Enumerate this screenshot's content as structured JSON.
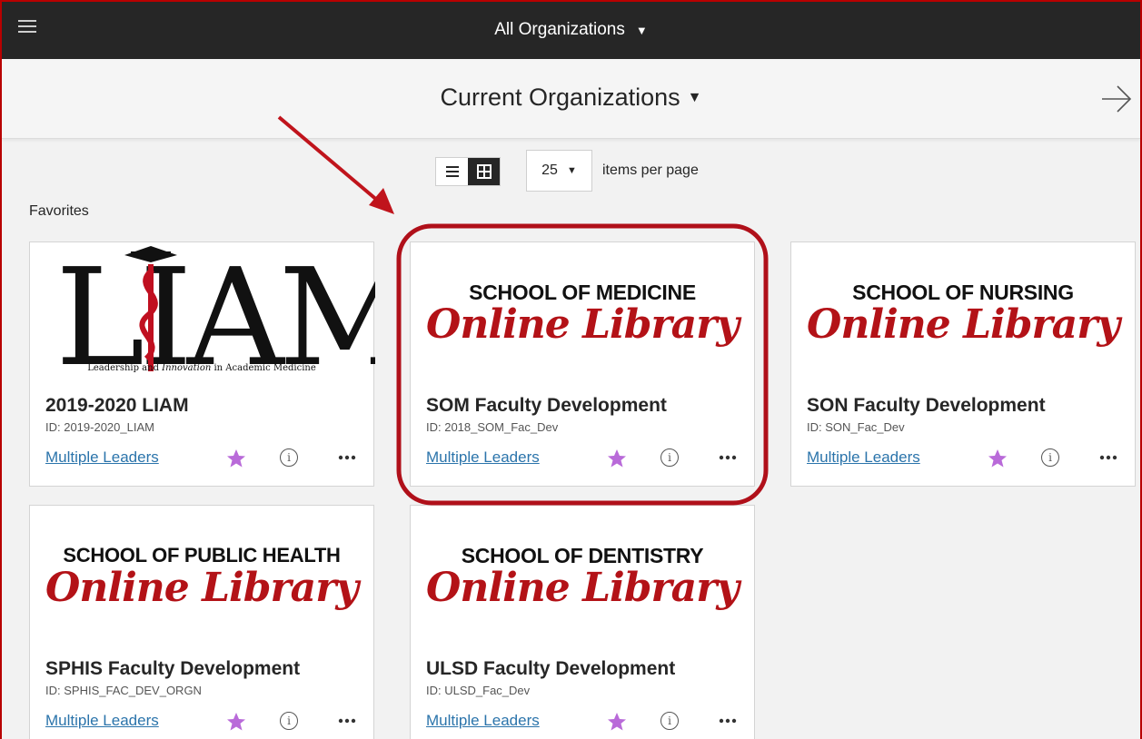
{
  "topbar": {
    "org_selector": "All Organizations"
  },
  "header": {
    "title": "Current Organizations"
  },
  "toolbar": {
    "per_page_value": "25",
    "per_page_label": "items per page"
  },
  "section": {
    "favorites_label": "Favorites"
  },
  "colors": {
    "accent_red": "#b80000",
    "star_purple": "#b96ad9",
    "link_blue": "#2b74ab",
    "logo_red": "#b31217"
  },
  "cards": [
    {
      "title": "2019-2020 LIAM",
      "id": "ID: 2019-2020_LIAM",
      "leaders": "Multiple Leaders",
      "logo": {
        "big": "LIAM",
        "tagline_a": "Leadership and ",
        "tagline_b": "Innovation",
        "tagline_c": " in Academic Medicine"
      }
    },
    {
      "title": "SOM Faculty Development",
      "id": "ID: 2018_SOM_Fac_Dev",
      "leaders": "Multiple Leaders",
      "logo": {
        "school": "SCHOOL OF MEDICINE",
        "online": "Online Library"
      }
    },
    {
      "title": "SON Faculty Development",
      "id": "ID: SON_Fac_Dev",
      "leaders": "Multiple Leaders",
      "logo": {
        "school": "SCHOOL OF NURSING",
        "online": "Online Library"
      }
    },
    {
      "title": "SPHIS Faculty Development",
      "id": "ID: SPHIS_FAC_DEV_ORGN",
      "leaders": "Multiple Leaders",
      "logo": {
        "school": "SCHOOL OF PUBLIC HEALTH",
        "online": "Online Library"
      }
    },
    {
      "title": "ULSD Faculty Development",
      "id": "ID: ULSD_Fac_Dev",
      "leaders": "Multiple Leaders",
      "logo": {
        "school": "SCHOOL OF DENTISTRY",
        "online": "Online Library"
      }
    }
  ],
  "icons": {
    "menu": "hamburger-icon",
    "next": "arrow-right-icon",
    "list_view": "list-view-icon",
    "grid_view": "grid-view-icon",
    "favorite": "star-icon",
    "info": "info-icon",
    "more": "more-options-icon"
  }
}
